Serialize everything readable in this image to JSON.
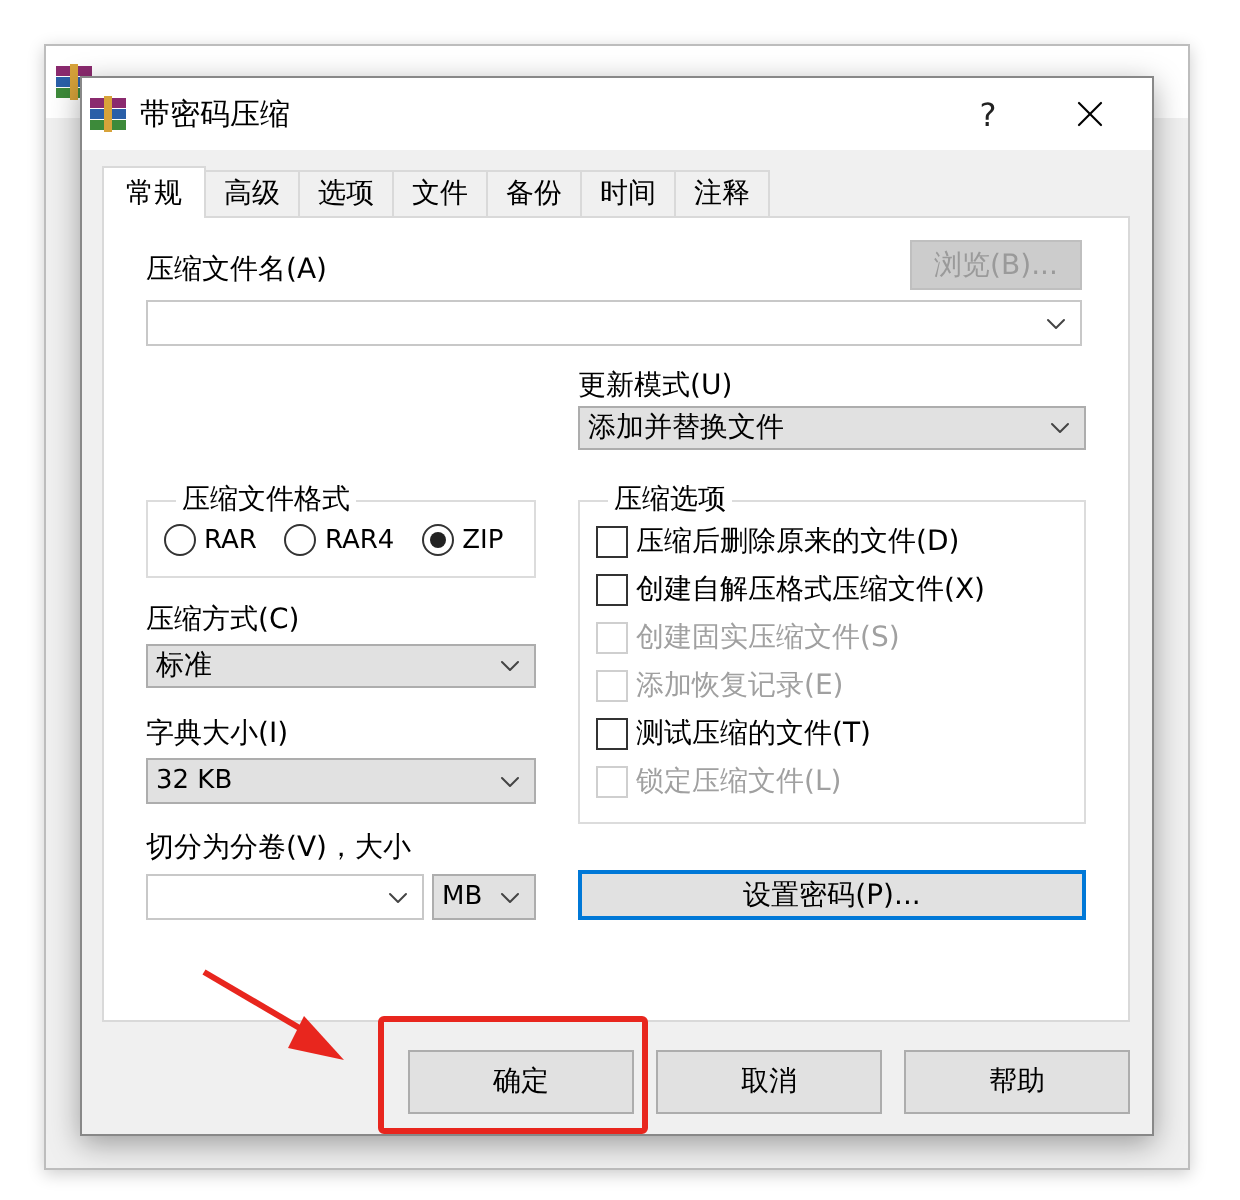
{
  "dialog": {
    "title": "带密码压缩",
    "help": "?"
  },
  "tabs": [
    {
      "label": "常规",
      "selected": true
    },
    {
      "label": "高级",
      "selected": false
    },
    {
      "label": "选项",
      "selected": false
    },
    {
      "label": "文件",
      "selected": false
    },
    {
      "label": "备份",
      "selected": false
    },
    {
      "label": "时间",
      "selected": false
    },
    {
      "label": "注释",
      "selected": false
    }
  ],
  "archive_name": {
    "label": "压缩文件名(A)",
    "browse_button": {
      "label": "浏览(B)...",
      "disabled": true
    }
  },
  "update_mode": {
    "label": "更新模式(U)",
    "value": "添加并替换文件"
  },
  "archive_format": {
    "legend": "压缩文件格式",
    "options": [
      {
        "label": "RAR",
        "selected": false
      },
      {
        "label": "RAR4",
        "selected": false
      },
      {
        "label": "ZIP",
        "selected": true
      }
    ]
  },
  "compression_options": {
    "legend": "压缩选项",
    "items": [
      {
        "label": "压缩后删除原来的文件(D)",
        "checked": false,
        "disabled": false
      },
      {
        "label": "创建自解压格式压缩文件(X)",
        "checked": false,
        "disabled": false
      },
      {
        "label": "创建固实压缩文件(S)",
        "checked": false,
        "disabled": true
      },
      {
        "label": "添加恢复记录(E)",
        "checked": false,
        "disabled": true
      },
      {
        "label": "测试压缩的文件(T)",
        "checked": false,
        "disabled": false
      },
      {
        "label": "锁定压缩文件(L)",
        "checked": false,
        "disabled": true
      }
    ]
  },
  "method": {
    "label": "压缩方式(C)",
    "value": "标准"
  },
  "dictionary": {
    "label": "字典大小(I)",
    "value": "32 KB"
  },
  "split": {
    "label": "切分为分卷(V)，大小",
    "unit": "MB"
  },
  "password_button": {
    "label": "设置密码(P)...",
    "focused": true
  },
  "buttons": [
    {
      "label": "确定",
      "highlighted": true
    },
    {
      "label": "取消",
      "highlighted": false
    },
    {
      "label": "帮助",
      "highlighted": false
    }
  ]
}
